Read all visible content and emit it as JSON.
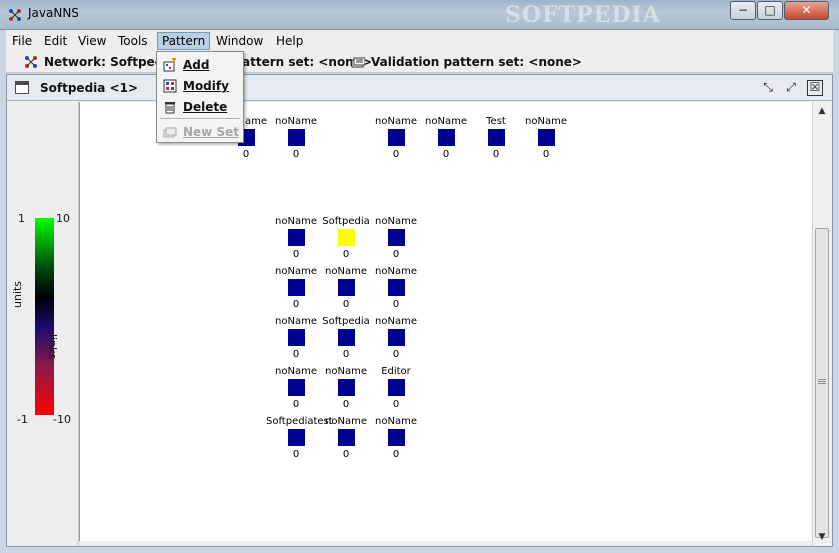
{
  "window": {
    "title": "JavaNNS",
    "watermark": "SOFTPEDIA",
    "controls": {
      "minimize": "−",
      "maximize": "□",
      "close": "✕"
    }
  },
  "menubar": {
    "items": [
      {
        "label": "File"
      },
      {
        "label": "Edit"
      },
      {
        "label": "View"
      },
      {
        "label": "Tools"
      },
      {
        "label": "Pattern",
        "open": true
      },
      {
        "label": "Window"
      },
      {
        "label": "Help"
      }
    ]
  },
  "infobar": {
    "network": "Network: Softpedia",
    "training": "attern set: <none>",
    "validation": "Validation pattern set: <none>"
  },
  "pattern_menu": {
    "items": [
      {
        "label": "Add",
        "icon": "add-pattern-icon",
        "enabled": true
      },
      {
        "label": "Modify",
        "icon": "modify-pattern-icon",
        "enabled": true
      },
      {
        "label": "Delete",
        "icon": "delete-pattern-icon",
        "enabled": true
      },
      {
        "label": "New Set",
        "icon": "new-set-icon",
        "enabled": false
      }
    ]
  },
  "internal_frame": {
    "title": "Softpedia <1>",
    "controls": {
      "iconify": "⤡",
      "maximize": "⤢",
      "close": "☒"
    }
  },
  "legend": {
    "units_max": "1",
    "units_min": "-1",
    "units_label": "units",
    "links_max": "10",
    "links_min": "-10",
    "links_label": "links",
    "colors": {
      "top": "#00ff00",
      "bottom": "#ff0000"
    }
  },
  "units": {
    "row1": [
      {
        "name": "noName",
        "value": "0",
        "color": "#000090"
      },
      {
        "name": "noName",
        "value": "0",
        "color": "#000090"
      },
      {
        "name": "noName",
        "value": "0",
        "color": "#000090"
      },
      {
        "name": "noName",
        "value": "0",
        "color": "#000090"
      },
      {
        "name": "Test",
        "value": "0",
        "color": "#000090"
      },
      {
        "name": "noName",
        "value": "0",
        "color": "#000090"
      }
    ],
    "grid": [
      {
        "name": "noName",
        "value": "0",
        "color": "#000090"
      },
      {
        "name": "Softpedia",
        "value": "0",
        "color": "#ffff00"
      },
      {
        "name": "noName",
        "value": "0",
        "color": "#000090"
      },
      {
        "name": "noName",
        "value": "0",
        "color": "#000090"
      },
      {
        "name": "noName",
        "value": "0",
        "color": "#000090"
      },
      {
        "name": "noName",
        "value": "0",
        "color": "#000090"
      },
      {
        "name": "noName",
        "value": "0",
        "color": "#000090"
      },
      {
        "name": "Softpedia",
        "value": "0",
        "color": "#000090"
      },
      {
        "name": "noName",
        "value": "0",
        "color": "#000090"
      },
      {
        "name": "noName",
        "value": "0",
        "color": "#000090"
      },
      {
        "name": "noName",
        "value": "0",
        "color": "#000090"
      },
      {
        "name": "Editor",
        "value": "0",
        "color": "#000090"
      },
      {
        "name": "Softpediatest",
        "value": "0",
        "color": "#000090"
      },
      {
        "name": "noName",
        "value": "0",
        "color": "#000090"
      },
      {
        "name": "noName",
        "value": "0",
        "color": "#000090"
      }
    ]
  }
}
